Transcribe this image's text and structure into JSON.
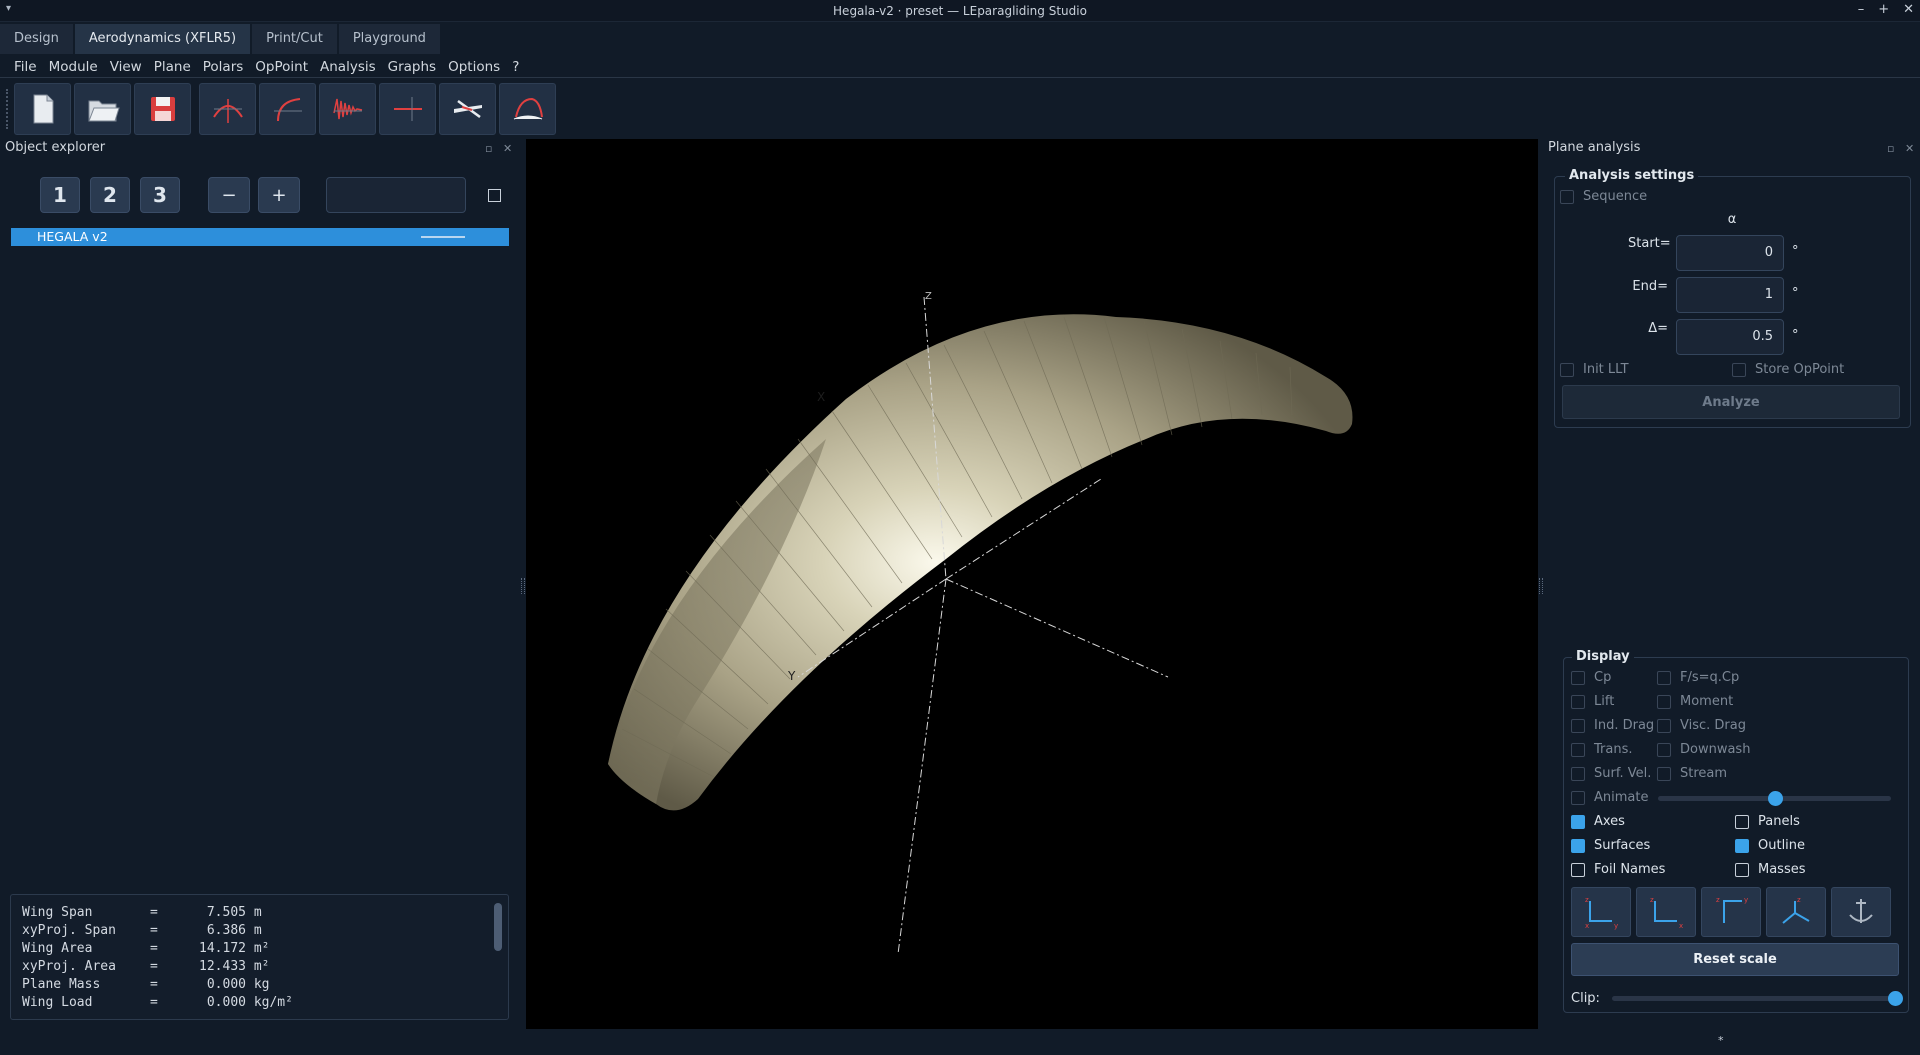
{
  "window": {
    "title": "Hegala-v2 · preset — LEparagliding Studio",
    "menu_glyph": "▾",
    "controls": [
      "–",
      "+",
      "✕"
    ]
  },
  "tabs": [
    {
      "label": "Design",
      "active": false
    },
    {
      "label": "Aerodynamics (XFLR5)",
      "active": true
    },
    {
      "label": "Print/Cut",
      "active": false
    },
    {
      "label": "Playground",
      "active": false
    }
  ],
  "menu": [
    "File",
    "Module",
    "View",
    "Plane",
    "Polars",
    "OpPoint",
    "Analysis",
    "Graphs",
    "Options",
    "?"
  ],
  "toolbar": {
    "icons": [
      "new-file-icon",
      "open-folder-icon",
      "save-icon",
      "wing-front-icon",
      "wing-polar-icon",
      "cp-graph-icon",
      "opp-view-icon",
      "plane-3d-icon",
      "foil-view-icon"
    ]
  },
  "explorer": {
    "title": "Object explorer",
    "levels": [
      "1",
      "2",
      "3"
    ],
    "collapse": "−",
    "expand": "+",
    "tree": [
      {
        "label": "HEGALA v2",
        "color": "#b9d6f0"
      }
    ],
    "properties": [
      {
        "name": "Wing Span",
        "value": "7.505",
        "unit": "m"
      },
      {
        "name": "xyProj. Span",
        "value": "6.386",
        "unit": "m"
      },
      {
        "name": "Wing Area",
        "value": "14.172",
        "unit": "m²"
      },
      {
        "name": "xyProj. Area",
        "value": "12.433",
        "unit": "m²"
      },
      {
        "name": "Plane Mass",
        "value": "0.000",
        "unit": "kg"
      },
      {
        "name": "Wing Load",
        "value": "0.000",
        "unit": "kg/m²"
      }
    ]
  },
  "viewport": {
    "axis_labels": {
      "x": "X",
      "y": "Y",
      "z": "Z"
    },
    "canopy_color": "#c9c4a8"
  },
  "analysis": {
    "dock_title": "Plane analysis",
    "settings_title": "Analysis settings",
    "sequence_label": "Sequence",
    "sequence_checked": false,
    "variable": "α",
    "start_label": "Start=",
    "start_value": "0",
    "end_label": "End=",
    "end_value": "1",
    "delta_label": "Δ=",
    "delta_value": "0.5",
    "unit": "°",
    "init_llt_label": "Init LLT",
    "store_opp_label": "Store OpPoint",
    "analyze_label": "Analyze"
  },
  "display": {
    "title": "Display",
    "disabled_options": [
      {
        "label": "Cp",
        "checked": false
      },
      {
        "label": "F/s=q.Cp",
        "checked": false
      },
      {
        "label": "Lift",
        "checked": false
      },
      {
        "label": "Moment",
        "checked": false
      },
      {
        "label": "Ind. Drag",
        "checked": false
      },
      {
        "label": "Visc. Drag",
        "checked": false
      },
      {
        "label": "Trans.",
        "checked": false
      },
      {
        "label": "Downwash",
        "checked": false
      },
      {
        "label": "Surf. Vel.",
        "checked": false
      },
      {
        "label": "Stream",
        "checked": false
      }
    ],
    "animate_label": "Animate",
    "animate_speed": 0.5,
    "options": [
      {
        "label": "Axes",
        "checked": true
      },
      {
        "label": "Panels",
        "checked": false
      },
      {
        "label": "Surfaces",
        "checked": true
      },
      {
        "label": "Outline",
        "checked": true
      },
      {
        "label": "Foil Names",
        "checked": false
      },
      {
        "label": "Masses",
        "checked": false
      }
    ],
    "view_buttons": [
      "x-view-icon",
      "y-view-icon",
      "z-view-icon",
      "iso-view-icon",
      "flip-view-icon"
    ],
    "reset_label": "Reset scale",
    "clip_label": "Clip:",
    "clip_value": 1.0,
    "accent": "#3ba3ea"
  },
  "status": {
    "marker": "*"
  }
}
